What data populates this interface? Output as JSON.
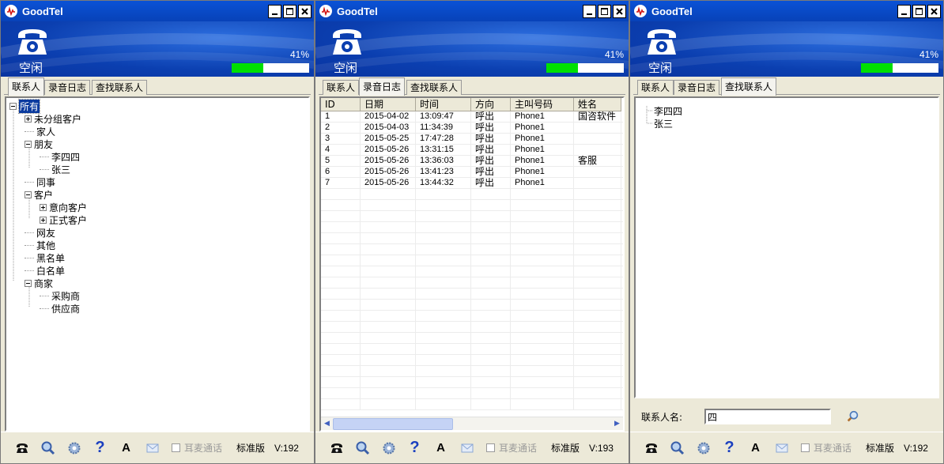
{
  "app_title": "GoodTel",
  "status": "空闲",
  "battery_percent": "41%",
  "battery_level": 0.41,
  "tabs": [
    "联系人",
    "录音日志",
    "查找联系人"
  ],
  "tree": [
    {
      "label": "所有",
      "depth": 0,
      "expander": "minus",
      "selected": true
    },
    {
      "label": "未分组客户",
      "depth": 1,
      "expander": "plus"
    },
    {
      "label": "家人",
      "depth": 1,
      "expander": ""
    },
    {
      "label": "朋友",
      "depth": 1,
      "expander": "minus"
    },
    {
      "label": "李四四",
      "depth": 2,
      "expander": ""
    },
    {
      "label": "张三",
      "depth": 2,
      "expander": ""
    },
    {
      "label": "同事",
      "depth": 1,
      "expander": ""
    },
    {
      "label": "客户",
      "depth": 1,
      "expander": "minus"
    },
    {
      "label": "意向客户",
      "depth": 2,
      "expander": "plus"
    },
    {
      "label": "正式客户",
      "depth": 2,
      "expander": "plus"
    },
    {
      "label": "网友",
      "depth": 1,
      "expander": ""
    },
    {
      "label": "其他",
      "depth": 1,
      "expander": ""
    },
    {
      "label": "黑名单",
      "depth": 1,
      "expander": ""
    },
    {
      "label": "白名单",
      "depth": 1,
      "expander": ""
    },
    {
      "label": "商家",
      "depth": 1,
      "expander": "minus"
    },
    {
      "label": "采购商",
      "depth": 2,
      "expander": ""
    },
    {
      "label": "供应商",
      "depth": 2,
      "expander": ""
    }
  ],
  "log": {
    "columns": [
      "ID",
      "日期",
      "时间",
      "方向",
      "主叫号码",
      "姓名"
    ],
    "rows": [
      [
        "1",
        "2015-04-02",
        "13:09:47",
        "呼出",
        "Phone1",
        "国咨软件"
      ],
      [
        "2",
        "2015-04-03",
        "11:34:39",
        "呼出",
        "Phone1",
        ""
      ],
      [
        "3",
        "2015-05-25",
        "17:47:28",
        "呼出",
        "Phone1",
        ""
      ],
      [
        "4",
        "2015-05-26",
        "13:31:15",
        "呼出",
        "Phone1",
        ""
      ],
      [
        "5",
        "2015-05-26",
        "13:36:03",
        "呼出",
        "Phone1",
        "客服"
      ],
      [
        "6",
        "2015-05-26",
        "13:41:23",
        "呼出",
        "Phone1",
        ""
      ],
      [
        "7",
        "2015-05-26",
        "13:44:32",
        "呼出",
        "Phone1",
        ""
      ]
    ]
  },
  "search": {
    "results": [
      "李四四",
      "张三"
    ],
    "label": "联系人名:",
    "value": "四"
  },
  "toolbar": {
    "help": "?",
    "font": "A",
    "headset_label": "耳麦通话",
    "edition": "标准版",
    "versions": [
      "V:192",
      "V:193",
      "V:192"
    ]
  },
  "colors": {
    "title_bar": "#0a52d6",
    "header_bg": "#0b3fb0",
    "battery_fill": "#00e000",
    "selection": "#0a3a9e"
  }
}
